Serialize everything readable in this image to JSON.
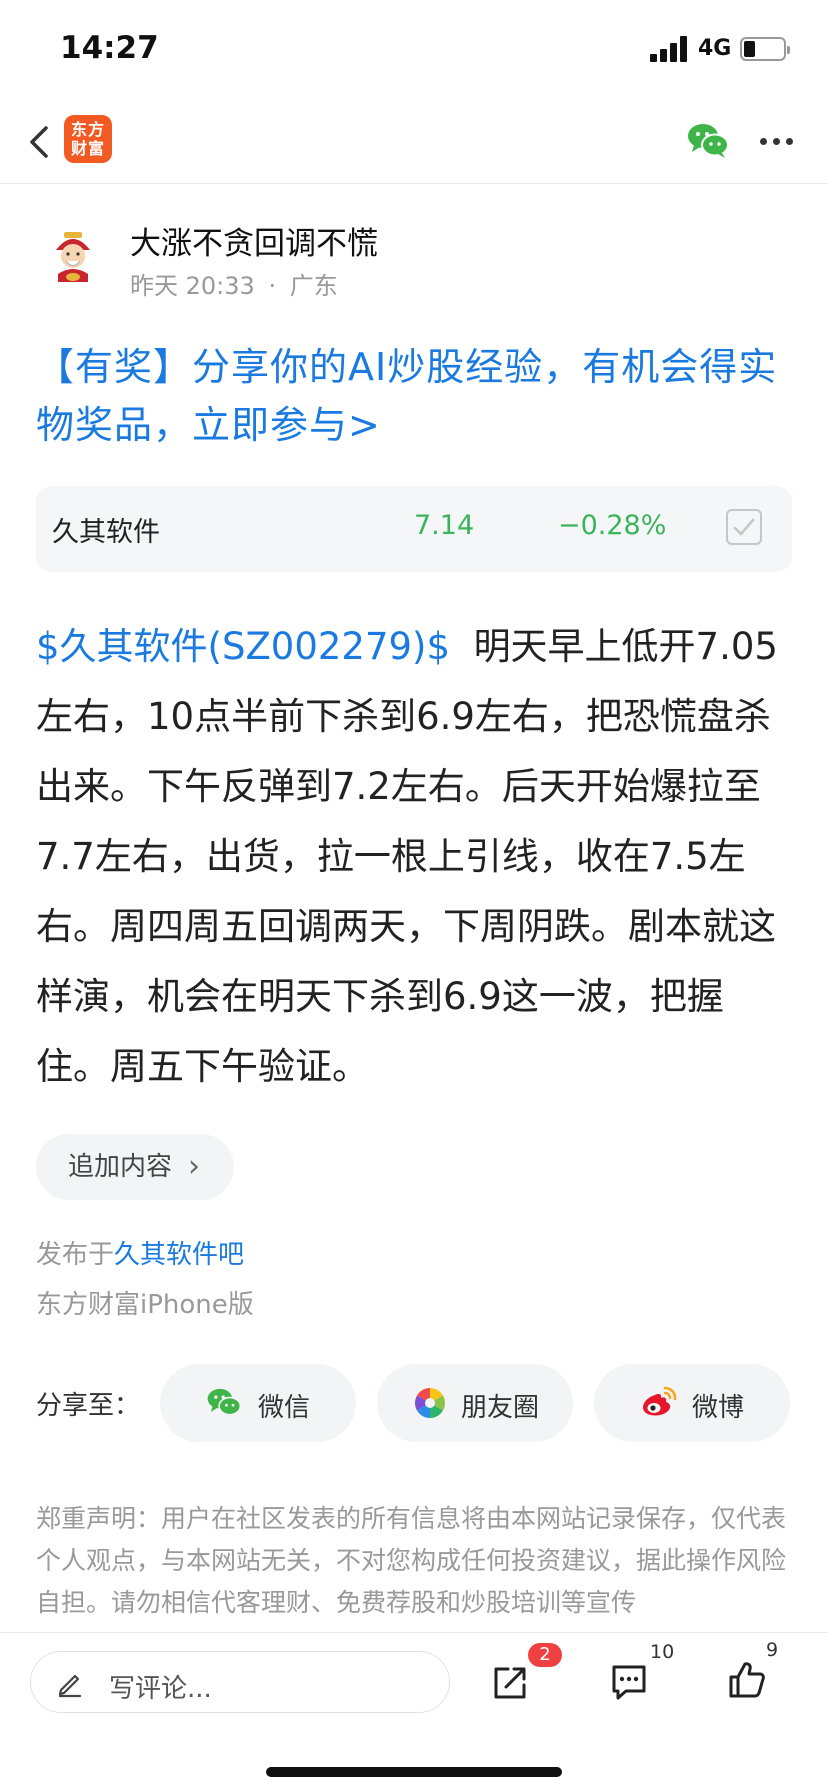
{
  "status_bar": {
    "time": "14:27",
    "network": "4G",
    "battery_level": 0.3
  },
  "nav": {
    "logo_line1": "东方",
    "logo_line2": "财富",
    "wechat_icon": "wechat-icon",
    "more_icon": "more-icon"
  },
  "author": {
    "name": "大涨不贪回调不慌",
    "time": "昨天 20:33",
    "separator": "·",
    "location": "广东"
  },
  "promo": {
    "text": "【有奖】分享你的AI炒股经验，有机会得实物奖品，立即参与>"
  },
  "stock_card": {
    "name": "久其软件",
    "price": "7.14",
    "change": "−0.28%",
    "color": "#3bb45b"
  },
  "post": {
    "stock_tag": "$久其软件(SZ002279)$",
    "body": "明天早上低开7.05左右，10点半前下杀到6.9左右，把恐慌盘杀出来。下午反弹到7.2左右。后天开始爆拉至7.7左右，出货，拉一根上引线，收在7.5左右。周四周五回调两天，下周阴跌。剧本就这样演，机会在明天下杀到6.9这一波，把握住。周五下午验证。"
  },
  "append": {
    "label": "追加内容"
  },
  "publish": {
    "prefix": "发布于",
    "bar": "久其软件吧",
    "client": "东方财富iPhone版"
  },
  "share": {
    "label": "分享至：",
    "wechat": "微信",
    "moments": "朋友圈",
    "weibo": "微博"
  },
  "disclaimer": "郑重声明：用户在社区发表的所有信息将由本网站记录保存，仅代表个人观点，与本网站无关，不对您构成任何投资建议，据此操作风险自担。请勿相信代客理财、免费荐股和炒股培训等宣传",
  "bottom_bar": {
    "comment_placeholder": "写评论...",
    "share_count": "2",
    "comment_count": "10",
    "like_count": "9"
  },
  "colors": {
    "link_blue": "#1a7ae0",
    "brand_orange": "#f15a22",
    "down_green": "#3bb45b",
    "badge_red": "#f04142"
  }
}
